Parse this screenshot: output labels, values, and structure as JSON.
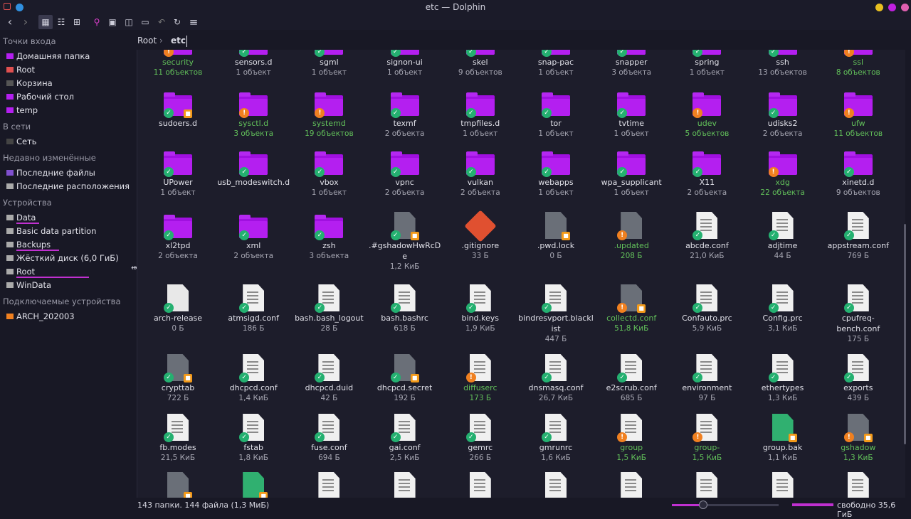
{
  "window": {
    "title": "etc — Dolphin",
    "dot_colors": {
      "yellow": "#e8c020",
      "magenta": "#c020e0",
      "pink": "#e060b0",
      "blue": "#3090e0",
      "red": "#e05050"
    }
  },
  "toolbar": {
    "back": "‹",
    "forward": "›",
    "icons_view": "▦",
    "compact_view": "☷",
    "details_view": "⊞",
    "search": "⚲",
    "preview": "▣",
    "split": "◫",
    "terminal": "▭",
    "undo": "↶",
    "reload": "↻",
    "menu": "≡"
  },
  "sidebar": {
    "sections": [
      {
        "title": "Точки входа",
        "items": [
          {
            "label": "Домашняя папка",
            "icon": "home-folder-icon",
            "color": "#b41ff0"
          },
          {
            "label": "Root",
            "icon": "root-folder-icon",
            "color": "#e05050"
          },
          {
            "label": "Корзина",
            "icon": "trash-icon",
            "color": "#555"
          },
          {
            "label": "Рабочий стол",
            "icon": "desktop-folder-icon",
            "color": "#b41ff0"
          },
          {
            "label": "temp",
            "icon": "folder-icon",
            "color": "#b41ff0"
          }
        ]
      },
      {
        "title": "В сети",
        "items": [
          {
            "label": "Сеть",
            "icon": "network-icon",
            "color": "#444"
          }
        ]
      },
      {
        "title": "Недавно изменённые",
        "items": [
          {
            "label": "Последние файлы",
            "icon": "recent-files-icon",
            "color": "#8050d0"
          },
          {
            "label": "Последние расположения",
            "icon": "recent-locations-icon",
            "color": "#aaa"
          }
        ]
      },
      {
        "title": "Устройства",
        "items": [
          {
            "label": "Data",
            "icon": "drive-icon",
            "color": "#aaa"
          },
          {
            "label": "Basic data partition",
            "icon": "drive-icon",
            "color": "#aaa"
          },
          {
            "label": "Backups",
            "icon": "drive-icon",
            "color": "#aaa"
          },
          {
            "label": "Жёсткий диск (6,0 ГиБ)",
            "icon": "drive-icon",
            "color": "#aaa"
          },
          {
            "label": "Root",
            "icon": "drive-icon",
            "color": "#aaa"
          },
          {
            "label": "WinData",
            "icon": "drive-icon",
            "color": "#aaa"
          }
        ]
      },
      {
        "title": "Подключаемые устройства",
        "items": [
          {
            "label": "ARCH_202003",
            "icon": "usb-drive-icon",
            "color": "#f08020"
          }
        ]
      }
    ]
  },
  "breadcrumb": {
    "root": "Root",
    "separator": "›",
    "current": "etc"
  },
  "files": [
    {
      "name": "security",
      "info": "11 объектов",
      "kind": "folder",
      "mod": true,
      "emblem": "warn"
    },
    {
      "name": "sensors.d",
      "info": "1 объект",
      "kind": "folder",
      "emblem": "ok"
    },
    {
      "name": "sgml",
      "info": "1 объект",
      "kind": "folder",
      "emblem": "ok"
    },
    {
      "name": "signon-ui",
      "info": "1 объект",
      "kind": "folder",
      "emblem": "ok"
    },
    {
      "name": "skel",
      "info": "9 объектов",
      "kind": "folder",
      "emblem": "ok"
    },
    {
      "name": "snap-pac",
      "info": "1 объект",
      "kind": "folder",
      "emblem": "ok"
    },
    {
      "name": "snapper",
      "info": "3 объекта",
      "kind": "folder",
      "emblem": "ok"
    },
    {
      "name": "spring",
      "info": "1 объект",
      "kind": "folder",
      "emblem": "ok"
    },
    {
      "name": "ssh",
      "info": "13 объектов",
      "kind": "folder",
      "emblem": "ok"
    },
    {
      "name": "ssl",
      "info": "8 объектов",
      "kind": "folder",
      "mod": true,
      "emblem": "warn"
    },
    {
      "name": "sudoers.d",
      "info": "",
      "kind": "folder",
      "emblem": "ok",
      "lock": true
    },
    {
      "name": "sysctl.d",
      "info": "3 объекта",
      "kind": "folder",
      "mod": true,
      "emblem": "warn"
    },
    {
      "name": "systemd",
      "info": "19 объектов",
      "kind": "folder",
      "mod": true,
      "emblem": "warn"
    },
    {
      "name": "texmf",
      "info": "2 объекта",
      "kind": "folder",
      "emblem": "ok"
    },
    {
      "name": "tmpfiles.d",
      "info": "1 объект",
      "kind": "folder",
      "emblem": "ok"
    },
    {
      "name": "tor",
      "info": "1 объект",
      "kind": "folder",
      "emblem": "ok"
    },
    {
      "name": "tvtime",
      "info": "1 объект",
      "kind": "folder",
      "emblem": "ok"
    },
    {
      "name": "udev",
      "info": "5 объектов",
      "kind": "folder",
      "mod": true,
      "emblem": "warn"
    },
    {
      "name": "udisks2",
      "info": "2 объекта",
      "kind": "folder",
      "emblem": "ok"
    },
    {
      "name": "ufw",
      "info": "11 объектов",
      "kind": "folder",
      "mod": true,
      "emblem": "warn"
    },
    {
      "name": "UPower",
      "info": "1 объект",
      "kind": "folder",
      "emblem": "ok"
    },
    {
      "name": "usb_modeswitch.d",
      "info": "",
      "kind": "folder",
      "emblem": "ok"
    },
    {
      "name": "vbox",
      "info": "1 объект",
      "kind": "folder",
      "emblem": "ok"
    },
    {
      "name": "vpnc",
      "info": "2 объекта",
      "kind": "folder",
      "emblem": "ok"
    },
    {
      "name": "vulkan",
      "info": "2 объекта",
      "kind": "folder",
      "emblem": "ok"
    },
    {
      "name": "webapps",
      "info": "1 объект",
      "kind": "folder",
      "emblem": "ok"
    },
    {
      "name": "wpa_supplicant",
      "info": "1 объект",
      "kind": "folder",
      "emblem": "ok"
    },
    {
      "name": "X11",
      "info": "2 объекта",
      "kind": "folder",
      "emblem": "ok"
    },
    {
      "name": "xdg",
      "info": "22 объекта",
      "kind": "folder",
      "mod": true,
      "emblem": "warn"
    },
    {
      "name": "xinetd.d",
      "info": "9 объектов",
      "kind": "folder",
      "emblem": "ok"
    },
    {
      "name": "xl2tpd",
      "info": "2 объекта",
      "kind": "folder",
      "emblem": "ok"
    },
    {
      "name": "xml",
      "info": "2 объекта",
      "kind": "folder",
      "emblem": "ok"
    },
    {
      "name": "zsh",
      "info": "3 объекта",
      "kind": "folder",
      "emblem": "ok"
    },
    {
      "name": ".#gshadowHwRcDe",
      "info": "1,2 КиБ",
      "kind": "gray",
      "emblem": "ok",
      "lock": true
    },
    {
      "name": ".gitignore",
      "info": "33 Б",
      "kind": "git"
    },
    {
      "name": ".pwd.lock",
      "info": "0 Б",
      "kind": "gray",
      "lock": true
    },
    {
      "name": ".updated",
      "info": "208 Б",
      "kind": "gray",
      "mod": true,
      "emblem": "warn"
    },
    {
      "name": "abcde.conf",
      "info": "21,0 КиБ",
      "kind": "doc",
      "emblem": "ok"
    },
    {
      "name": "adjtime",
      "info": "44 Б",
      "kind": "doc",
      "emblem": "ok"
    },
    {
      "name": "appstream.conf",
      "info": "769 Б",
      "kind": "doc",
      "emblem": "ok"
    },
    {
      "name": "arch-release",
      "info": "0 Б",
      "kind": "plain",
      "emblem": "ok"
    },
    {
      "name": "atmsigd.conf",
      "info": "186 Б",
      "kind": "doc",
      "emblem": "ok"
    },
    {
      "name": "bash.bash_logout",
      "info": "28 Б",
      "kind": "doc",
      "emblem": "ok"
    },
    {
      "name": "bash.bashrc",
      "info": "618 Б",
      "kind": "doc",
      "emblem": "ok"
    },
    {
      "name": "bind.keys",
      "info": "1,9 КиБ",
      "kind": "doc",
      "emblem": "ok"
    },
    {
      "name": "bindresvport.blacklist",
      "info": "447 Б",
      "kind": "doc",
      "emblem": "ok"
    },
    {
      "name": "collectd.conf",
      "info": "51,8 КиБ",
      "kind": "gray",
      "mod": true,
      "emblem": "warn",
      "lock": true
    },
    {
      "name": "Confauto.prc",
      "info": "5,9 КиБ",
      "kind": "doc",
      "emblem": "ok"
    },
    {
      "name": "Config.prc",
      "info": "3,1 КиБ",
      "kind": "doc",
      "emblem": "ok"
    },
    {
      "name": "cpufreq-bench.conf",
      "info": "175 Б",
      "kind": "doc",
      "emblem": "ok"
    },
    {
      "name": "crypttab",
      "info": "722 Б",
      "kind": "gray",
      "emblem": "ok",
      "lock": true
    },
    {
      "name": "dhcpcd.conf",
      "info": "1,4 КиБ",
      "kind": "doc",
      "emblem": "ok"
    },
    {
      "name": "dhcpcd.duid",
      "info": "42 Б",
      "kind": "doc",
      "emblem": "ok"
    },
    {
      "name": "dhcpcd.secret",
      "info": "192 Б",
      "kind": "gray",
      "emblem": "ok",
      "lock": true
    },
    {
      "name": "diffuserc",
      "info": "173 Б",
      "kind": "doc",
      "mod": true,
      "emblem": "warn"
    },
    {
      "name": "dnsmasq.conf",
      "info": "26,7 КиБ",
      "kind": "doc",
      "emblem": "ok"
    },
    {
      "name": "e2scrub.conf",
      "info": "685 Б",
      "kind": "doc",
      "emblem": "ok"
    },
    {
      "name": "environment",
      "info": "97 Б",
      "kind": "doc",
      "emblem": "ok"
    },
    {
      "name": "ethertypes",
      "info": "1,3 КиБ",
      "kind": "doc",
      "emblem": "ok"
    },
    {
      "name": "exports",
      "info": "439 Б",
      "kind": "doc",
      "emblem": "ok"
    },
    {
      "name": "fb.modes",
      "info": "21,5 КиБ",
      "kind": "doc",
      "emblem": "ok"
    },
    {
      "name": "fstab",
      "info": "1,8 КиБ",
      "kind": "doc",
      "emblem": "ok"
    },
    {
      "name": "fuse.conf",
      "info": "694 Б",
      "kind": "doc",
      "emblem": "ok"
    },
    {
      "name": "gai.conf",
      "info": "2,5 КиБ",
      "kind": "doc",
      "emblem": "ok"
    },
    {
      "name": "gemrc",
      "info": "266 Б",
      "kind": "doc",
      "emblem": "ok"
    },
    {
      "name": "gmrunrc",
      "info": "1,6 КиБ",
      "kind": "doc",
      "emblem": "ok"
    },
    {
      "name": "group",
      "info": "1,5 КиБ",
      "kind": "doc",
      "mod": true,
      "emblem": "warn"
    },
    {
      "name": "group-",
      "info": "1,5 КиБ",
      "kind": "doc",
      "mod": true,
      "emblem": "warn"
    },
    {
      "name": "group.bak",
      "info": "1,1 КиБ",
      "kind": "green",
      "lock": true
    },
    {
      "name": "gshadow",
      "info": "1,3 КиБ",
      "kind": "gray",
      "mod": true,
      "emblem": "warn",
      "lock": true
    },
    {
      "name": "",
      "info": "",
      "kind": "gray",
      "lock": true
    },
    {
      "name": "",
      "info": "",
      "kind": "green",
      "lock": true
    },
    {
      "name": "",
      "info": "",
      "kind": "doc"
    },
    {
      "name": "",
      "info": "",
      "kind": "doc"
    },
    {
      "name": "",
      "info": "",
      "kind": "doc"
    },
    {
      "name": "",
      "info": "",
      "kind": "doc"
    },
    {
      "name": "",
      "info": "",
      "kind": "doc"
    },
    {
      "name": "",
      "info": "",
      "kind": "doc"
    },
    {
      "name": "",
      "info": "",
      "kind": "doc"
    },
    {
      "name": "",
      "info": "",
      "kind": "doc"
    }
  ],
  "status": {
    "summary": "143 папки. 144 файла (1,3 МиБ)",
    "zoom_level": 0.29,
    "free_space": "свободно 35,6 ГиБ",
    "used_fraction": 1.0
  }
}
